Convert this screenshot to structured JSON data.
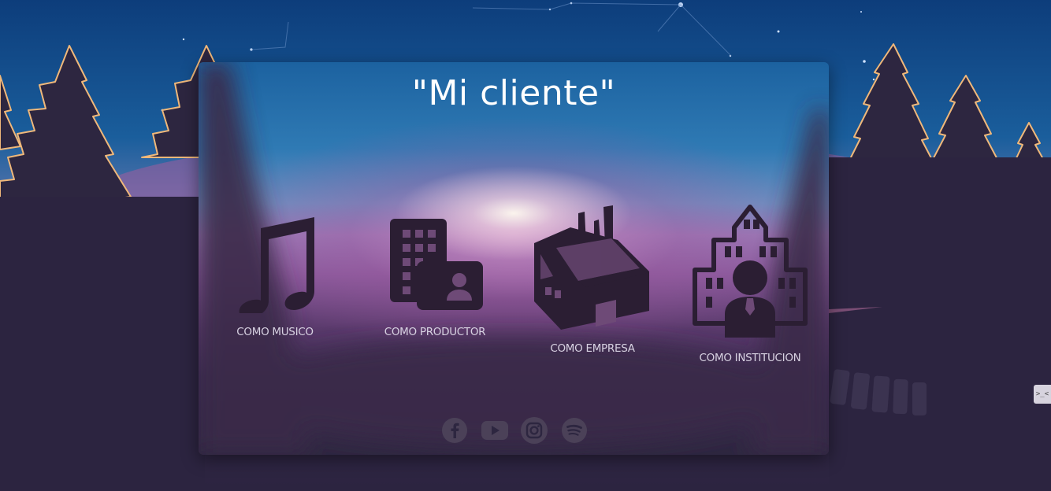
{
  "card": {
    "title": "\"Mi cliente\""
  },
  "options": [
    {
      "label": "COMO MUSICO",
      "icon": "music-note-icon"
    },
    {
      "label": "COMO PRODUCTOR",
      "icon": "building-contact-icon"
    },
    {
      "label": "COMO EMPRESA",
      "icon": "factory-icon"
    },
    {
      "label": "COMO INSTITUCION",
      "icon": "institution-icon"
    }
  ],
  "socials": [
    {
      "icon": "facebook-icon"
    },
    {
      "icon": "youtube-icon"
    },
    {
      "icon": "instagram-icon"
    },
    {
      "icon": "spotify-icon"
    }
  ],
  "side_tab": {
    "label": ">_<"
  },
  "colors": {
    "sky_top": "#0e3f7c",
    "night_ground": "#2c2440",
    "tree_silhouette": "#2d2640",
    "tree_rim_light": "#f0b87a",
    "icon_fill": "#2b1e33",
    "social_icon": "#4b4158",
    "title_text": "#ffffff",
    "label_text": "#d8d2e2"
  }
}
